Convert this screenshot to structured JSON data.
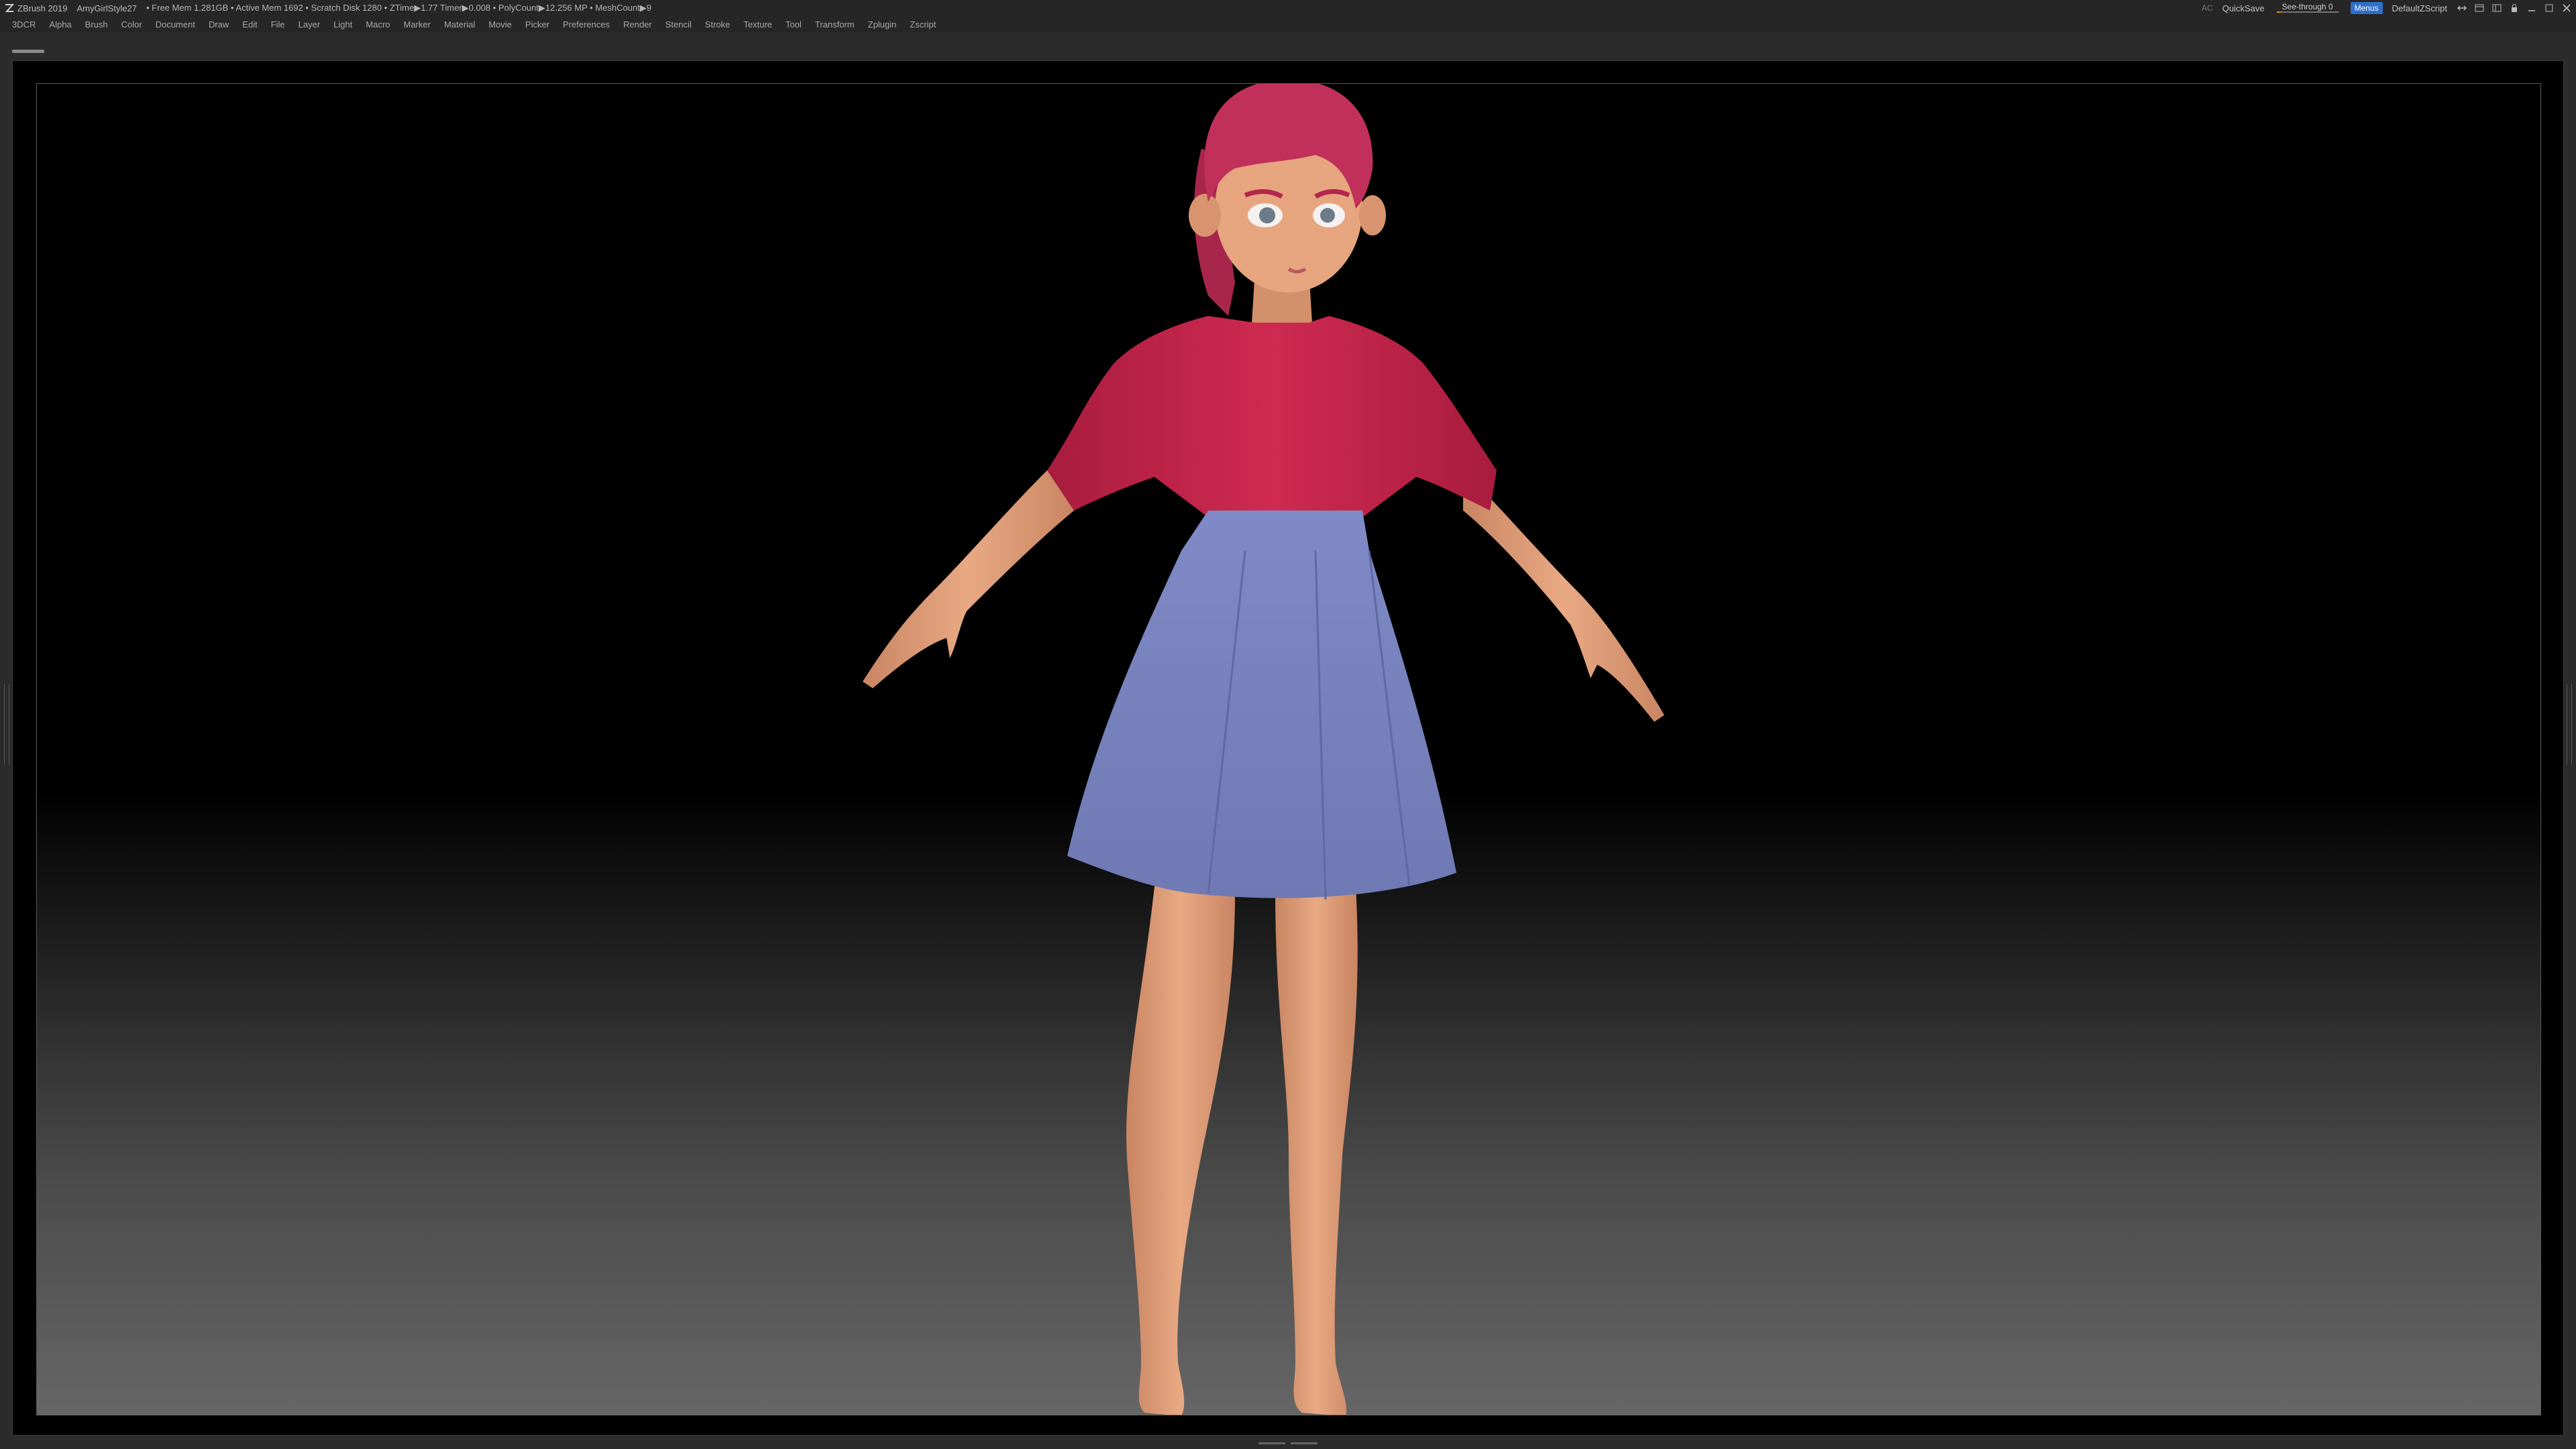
{
  "titlebar": {
    "app_name": "ZBrush 2019",
    "document_name": "AmyGirlStyle27",
    "stats": "• Free Mem 1.281GB • Active Mem 1692 • Scratch Disk 1280 • ZTime▶1.77 Timer▶0.008 • PolyCount▶12.256 MP • MeshCount▶9",
    "ac_label": "AC",
    "quicksave_label": "QuickSave",
    "seethrough_label": "See-through",
    "seethrough_value": "0",
    "menus_label": "Menus",
    "script_label": "DefaultZScript",
    "accent_color": "#2f6fc9",
    "slider_color": "#e88a1a"
  },
  "menubar": {
    "items": [
      "3DCR",
      "Alpha",
      "Brush",
      "Color",
      "Document",
      "Draw",
      "Edit",
      "File",
      "Layer",
      "Light",
      "Macro",
      "Marker",
      "Material",
      "Movie",
      "Picker",
      "Preferences",
      "Render",
      "Stencil",
      "Stroke",
      "Texture",
      "Tool",
      "Transform",
      "Zplugin",
      "Zscript"
    ]
  },
  "viewport": {
    "subject": "3D character model",
    "background_top": "#000000",
    "background_bottom": "#666666",
    "colors": {
      "skin": "#e2a179",
      "shirt": "#c8254a",
      "skirt": "#7a85c0",
      "hair": "#c0305a"
    }
  }
}
